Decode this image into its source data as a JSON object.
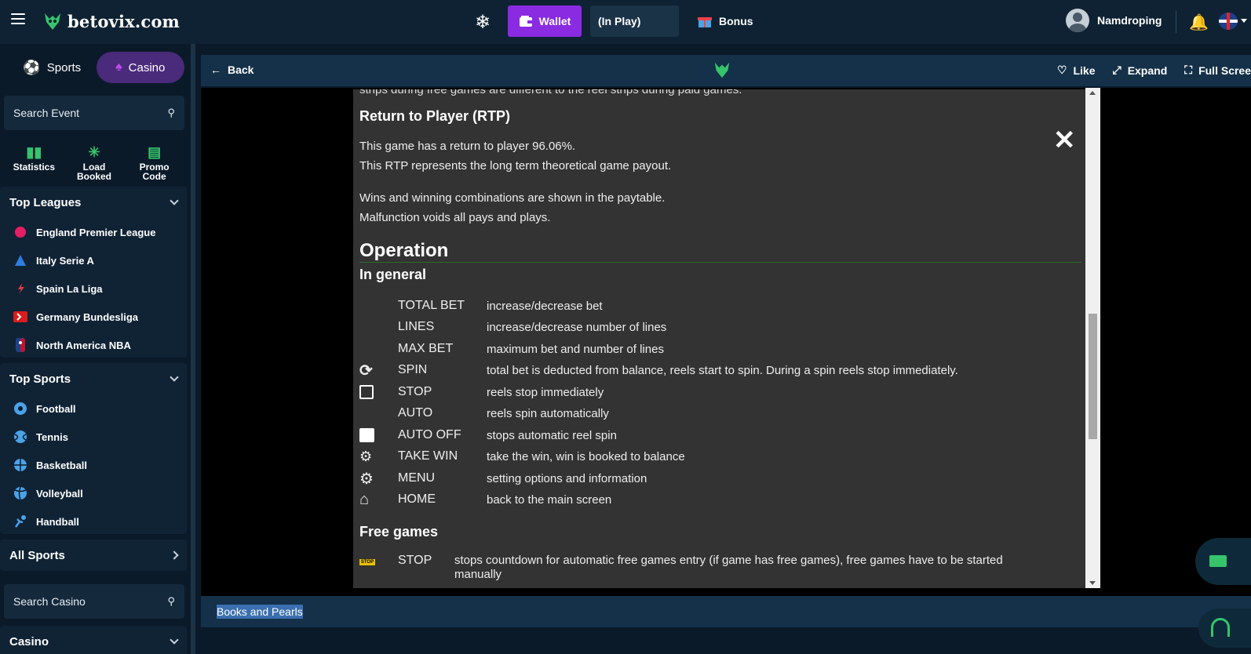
{
  "header": {
    "brand": "betovix.com",
    "wallet": "Wallet",
    "in_play": "(In Play)",
    "bonus": "Bonus",
    "username": "Namdroping"
  },
  "sidebar": {
    "tabs": [
      {
        "label": "Sports"
      },
      {
        "label": "Casino"
      }
    ],
    "search_event": "Search Event",
    "quick": [
      {
        "label": "Statistics"
      },
      {
        "label": "Load Booked"
      },
      {
        "label": "Promo Code"
      }
    ],
    "top_leagues": {
      "title": "Top Leagues",
      "items": [
        {
          "label": "England Premier League",
          "icon": "premier-league-icon",
          "color": "#e21e64"
        },
        {
          "label": "Italy Serie A",
          "icon": "serie-a-icon",
          "color": "#2f7de0"
        },
        {
          "label": "Spain La Liga",
          "icon": "la-liga-icon",
          "color": "#e23b3b"
        },
        {
          "label": "Germany Bundesliga",
          "icon": "bundesliga-icon",
          "color": "#d91c1c"
        },
        {
          "label": "North America NBA",
          "icon": "nba-icon",
          "color": "#1d428a"
        }
      ]
    },
    "top_sports": {
      "title": "Top Sports",
      "items": [
        {
          "label": "Football"
        },
        {
          "label": "Tennis"
        },
        {
          "label": "Basketball"
        },
        {
          "label": "Volleyball"
        },
        {
          "label": "Handball"
        }
      ]
    },
    "all_sports": "All Sports",
    "search_casino": "Search Casino",
    "casino": "Casino"
  },
  "gamebar": {
    "back": "Back",
    "like": "Like",
    "expand": "Expand",
    "fullscreen": "Full Scree"
  },
  "doc": {
    "cut_line": "strips during free games are different to the reel strips during paid games.",
    "rtp_title": "Return to Player (RTP)",
    "rtp_line1": "This game has a return to player 96.06%.",
    "rtp_line2": "This RTP represents the long term theoretical game payout.",
    "wins_line1": "Wins and winning combinations are shown in the paytable.",
    "wins_line2": "Malfunction voids all pays and plays.",
    "operation": "Operation",
    "in_general": "In general",
    "controls": [
      {
        "key": "TOTAL BET",
        "desc": "increase/decrease bet"
      },
      {
        "key": "LINES",
        "desc": "increase/decrease number of lines"
      },
      {
        "key": "MAX BET",
        "desc": "maximum bet and number of lines"
      },
      {
        "key": "SPIN",
        "desc": "total bet is deducted from balance, reels start to spin. During a spin reels stop immediately."
      },
      {
        "key": "STOP",
        "desc": "reels stop immediately"
      },
      {
        "key": "AUTO",
        "desc": "reels spin automatically"
      },
      {
        "key": "AUTO OFF",
        "desc": "stops automatic reel spin"
      },
      {
        "key": "TAKE WIN",
        "desc": "take the win, win is booked to balance"
      },
      {
        "key": "MENU",
        "desc": "setting options and information"
      },
      {
        "key": "HOME",
        "desc": "back to the main screen"
      }
    ],
    "free_games": "Free games",
    "free_stop_badge": "STOP",
    "free_stop_key": "STOP",
    "free_stop_desc": "stops countdown for automatic free games entry (if game has free games), free games have to be started manually"
  },
  "game_title": "Books and Pearls"
}
